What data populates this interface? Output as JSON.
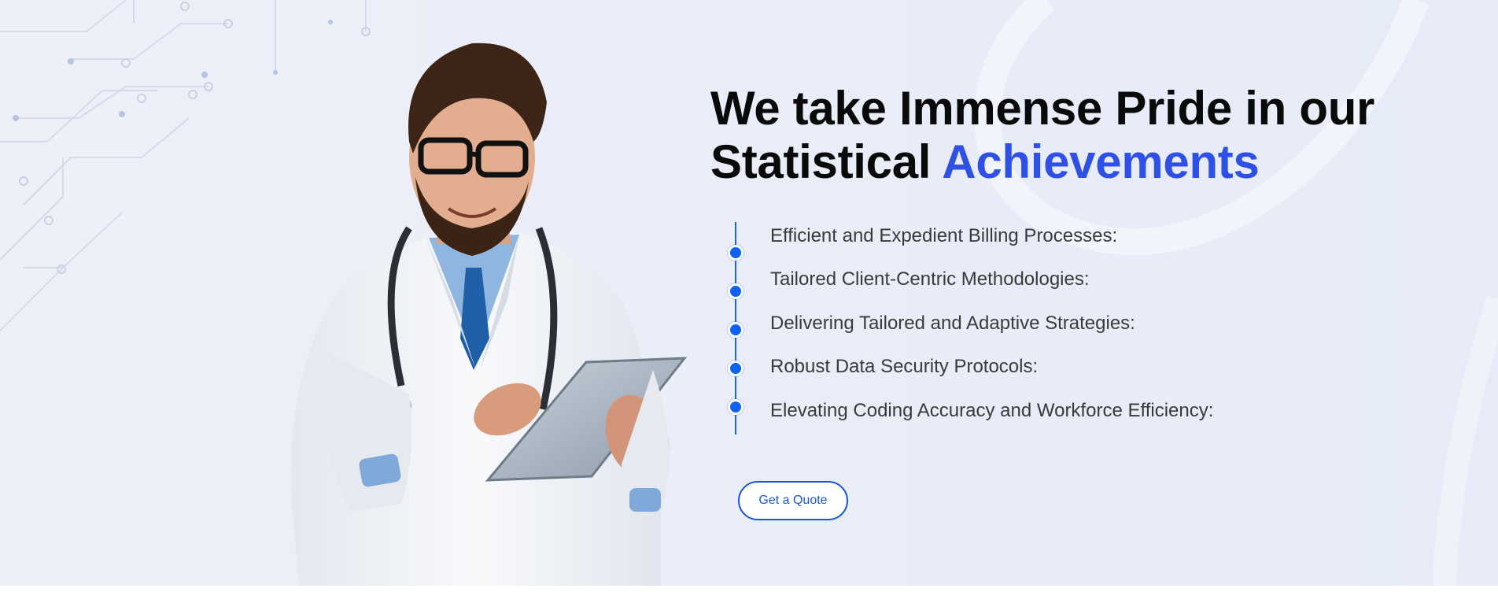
{
  "heading": {
    "line1": "We take Immense Pride in our",
    "line2_prefix": "Statistical ",
    "line2_accent": "Achievements"
  },
  "timeline": [
    "Efficient and Expedient Billing Processes:",
    "Tailored Client-Centric Methodologies:",
    "Delivering Tailored and Adaptive Strategies:",
    "Robust Data Security Protocols:",
    "Elevating Coding Accuracy and Workforce Efficiency:"
  ],
  "cta": {
    "label": "Get a Quote"
  },
  "colors": {
    "accent": "#2f50e6",
    "timeline_blue": "#0f62f0",
    "button_blue": "#1757d6",
    "text_dark": "#0a0a0a",
    "text_body": "#3a3a3a",
    "background": "#eceff8"
  },
  "image": {
    "subject": "doctor-with-tablet"
  }
}
